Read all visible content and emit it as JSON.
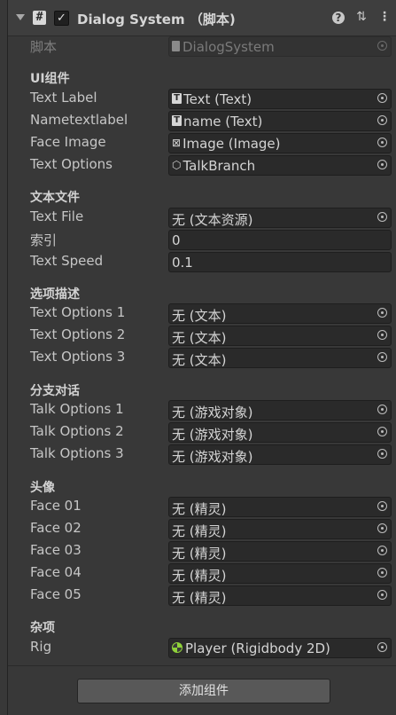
{
  "header": {
    "title": "Dialog System （脚本)",
    "enabled": "✓",
    "script_icon": "#"
  },
  "script": {
    "label": "脚本",
    "value": "DialogSystem"
  },
  "sections": {
    "ui": "UI组件",
    "text_file": "文本文件",
    "option_desc": "选项描述",
    "branch": "分支对话",
    "avatar": "头像",
    "misc": "杂项"
  },
  "ui": {
    "text_label": {
      "label": "Text Label",
      "value": "Text  (Text)"
    },
    "name_text_label": {
      "label": "Nametextlabel",
      "value": "name (Text)"
    },
    "face_image": {
      "label": "Face Image",
      "value": "Image (Image)"
    },
    "text_options": {
      "label": "Text Options",
      "value": "TalkBranch"
    }
  },
  "text_file": {
    "file": {
      "label": "Text File",
      "value": "无 (文本资源)"
    },
    "index": {
      "label": "索引",
      "value": "0"
    },
    "speed": {
      "label": "Text Speed",
      "value": "0.1"
    }
  },
  "option_desc": [
    {
      "label": "Text Options 1",
      "value": "无 (文本)"
    },
    {
      "label": "Text Options 2",
      "value": "无 (文本)"
    },
    {
      "label": "Text Options 3",
      "value": "无 (文本)"
    }
  ],
  "branch": [
    {
      "label": "Talk Options 1",
      "value": "无 (游戏对象)"
    },
    {
      "label": "Talk Options 2",
      "value": "无 (游戏对象)"
    },
    {
      "label": "Talk Options 3",
      "value": "无 (游戏对象)"
    }
  ],
  "faces": [
    {
      "label": "Face 01",
      "value": "无 (精灵)"
    },
    {
      "label": "Face 02",
      "value": "无 (精灵)"
    },
    {
      "label": "Face 03",
      "value": "无 (精灵)"
    },
    {
      "label": "Face 04",
      "value": "无 (精灵)"
    },
    {
      "label": "Face 05",
      "value": "无 (精灵)"
    }
  ],
  "misc": {
    "rig": {
      "label": "Rig",
      "value": "Player (Rigidbody 2D)"
    }
  },
  "add_component_label": "添加组件",
  "icons": {
    "fold": "chevron-down-icon",
    "help": "help-icon",
    "preset": "preset-icon",
    "menu": "kebab-menu-icon",
    "picker": "object-picker-icon"
  }
}
